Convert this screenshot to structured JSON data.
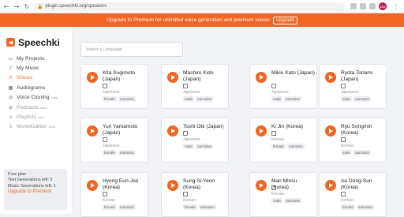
{
  "browser": {
    "url": "plugin.speechki.org/speakers",
    "profile_initials": "MM"
  },
  "banner": {
    "text": "Upgrade to Premium for unlimited voice generation and premium voices",
    "button": "Upgrade"
  },
  "brand": {
    "name": "Speechki"
  },
  "sidebar": {
    "items": [
      {
        "label": "My Projects",
        "icon": "folder-icon"
      },
      {
        "label": "My Music",
        "icon": "music-icon"
      },
      {
        "label": "Voices",
        "icon": "voices-icon"
      },
      {
        "label": "Audiograms",
        "icon": "audiogram-icon"
      },
      {
        "label": "Voice Cloning",
        "badge": "beta",
        "icon": "microphone-icon"
      },
      {
        "label": "Podcasts",
        "badge": "soon",
        "icon": "podcast-icon"
      },
      {
        "label": "Playlists",
        "badge": "soon",
        "icon": "playlist-icon"
      },
      {
        "label": "Monetization",
        "badge": "soon",
        "icon": "money-icon"
      }
    ],
    "plan": {
      "title": "Free plan",
      "text_generations": "Text Generations left: 2",
      "music_generations": "Music Generations left: 1",
      "upgrade": "Upgrade to Premium"
    }
  },
  "main": {
    "language_placeholder": "Select a Language",
    "voices": [
      {
        "name": "Kita Sugimoto (Japan)",
        "language": "Japanese",
        "tags": [
          "female",
          "narration"
        ]
      },
      {
        "name": "Mashiro Kido (Japan)",
        "language": "Japanese",
        "tags": [
          "male",
          "narration"
        ]
      },
      {
        "name": "Mikio Kato (Japan)",
        "language": "Japanese",
        "tags": [
          "male",
          "narration"
        ]
      },
      {
        "name": "Ryota Toriami (Japan)",
        "language": "Japanese",
        "tags": [
          "male",
          "narration"
        ]
      },
      {
        "name": "Yuri Yamamoto (Japan)",
        "language": "Japanese",
        "tags": [
          "female",
          "narration"
        ]
      },
      {
        "name": "Toshi Obi (Japan)",
        "language": "Japanese",
        "tags": [
          "male",
          "narration"
        ]
      },
      {
        "name": "Ki Jin (Korea)",
        "language": "Korean",
        "tags": [
          "female",
          "narration"
        ]
      },
      {
        "name": "Ryu Songmin (Korea)",
        "language": "Korean",
        "tags": [
          "male",
          "narration"
        ]
      },
      {
        "name": "Hyong Eun-Joo (Korea)",
        "language": "Korean",
        "tags": [
          "female",
          "narration"
        ]
      },
      {
        "name": "Sung Si-Yeon (Korea)",
        "language": "Korean",
        "tags": [
          "female",
          "narration"
        ]
      },
      {
        "name": "Man Minsu (Korea)",
        "language": "Korean",
        "tags": [
          "male",
          "narration"
        ]
      },
      {
        "name": "Ae Dong-Sun (Korea)",
        "language": "Korean",
        "tags": [
          "female",
          "narration"
        ]
      }
    ]
  },
  "colors": {
    "accent": "#f26522",
    "card_border": "#e1e4e8",
    "background": "#f1f3f6"
  }
}
